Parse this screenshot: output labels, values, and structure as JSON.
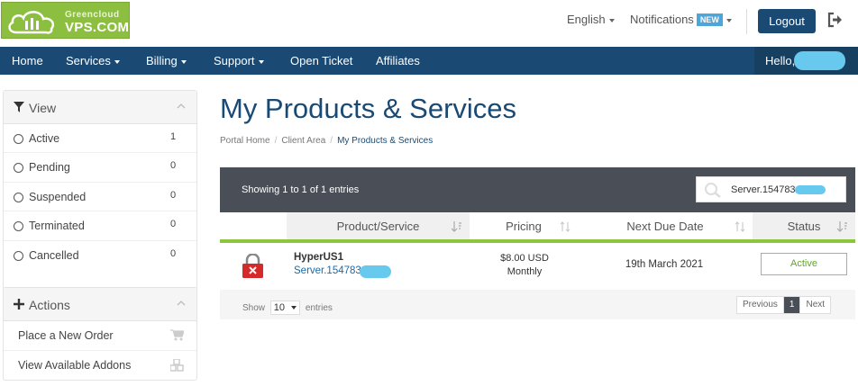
{
  "brand": {
    "line1": "Greencloud",
    "line2": "VPS.COM"
  },
  "header": {
    "language": "English",
    "notifications": "Notifications",
    "new_badge": "NEW",
    "logout": "Logout"
  },
  "nav": {
    "items": [
      "Home",
      "Services",
      "Billing",
      "Support",
      "Open Ticket",
      "Affiliates"
    ],
    "hello": "Hello,"
  },
  "sidebar": {
    "view": {
      "title": "View",
      "items": [
        {
          "label": "Active",
          "count": "1"
        },
        {
          "label": "Pending",
          "count": "0"
        },
        {
          "label": "Suspended",
          "count": "0"
        },
        {
          "label": "Terminated",
          "count": "0"
        },
        {
          "label": "Cancelled",
          "count": "0"
        }
      ]
    },
    "actions": {
      "title": "Actions",
      "items": [
        "Place a New Order",
        "View Available Addons"
      ]
    }
  },
  "main": {
    "title": "My Products & Services",
    "breadcrumb": [
      "Portal Home",
      "Client Area",
      "My Products & Services"
    ],
    "table": {
      "info": "Showing 1 to 1 of 1 entries",
      "search_value": "Server.154783",
      "columns": [
        "Product/Service",
        "Pricing",
        "Next Due Date",
        "Status"
      ],
      "rows": [
        {
          "product": "HyperUS1",
          "server": "Server.154783",
          "price": "$8.00 USD",
          "cycle": "Monthly",
          "due": "19th March 2021",
          "status": "Active"
        }
      ],
      "footer": {
        "show": "Show",
        "page_size": "10",
        "entries": "entries",
        "previous": "Previous",
        "page": "1",
        "next": "Next"
      }
    }
  },
  "colors": {
    "accent": "#1a4a73",
    "green": "#8cc63f",
    "table_header": "#4a4e57"
  }
}
